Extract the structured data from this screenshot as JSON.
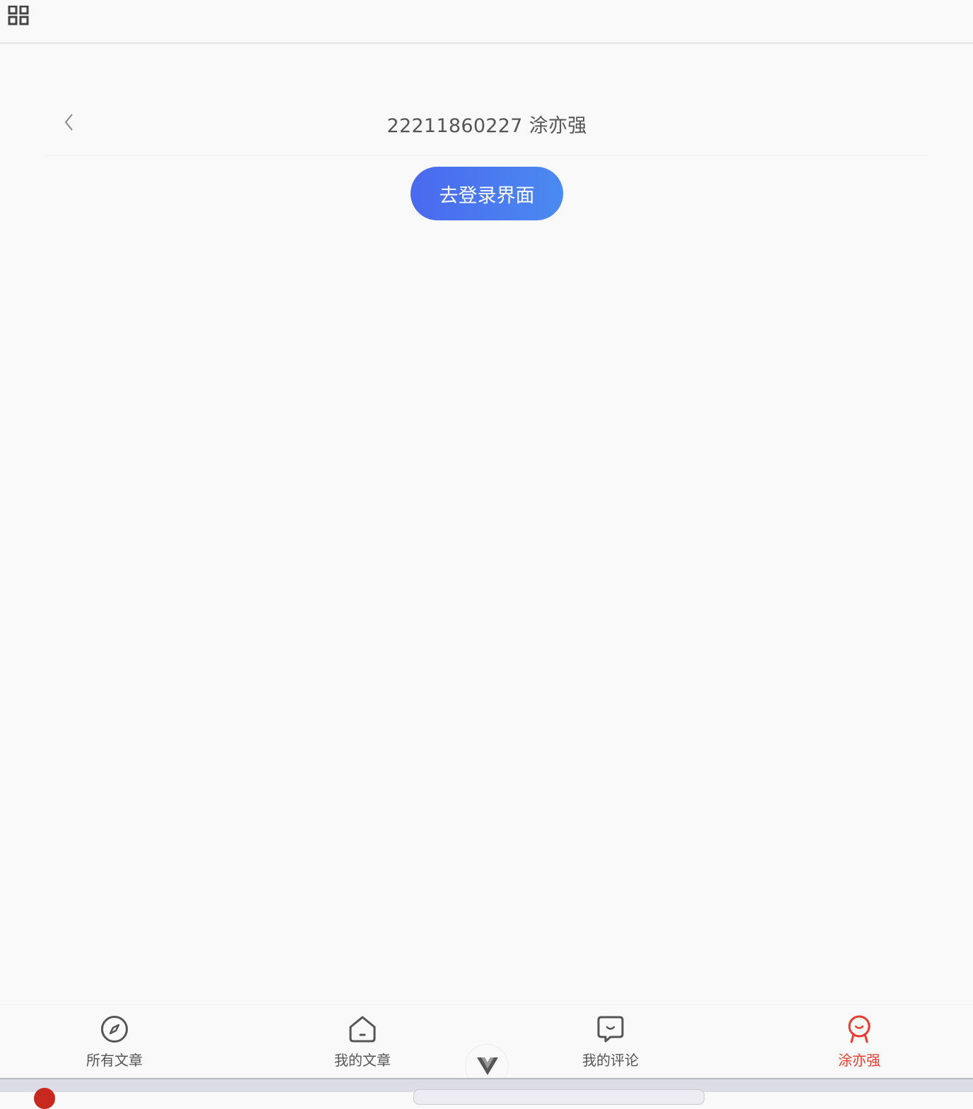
{
  "app": {
    "menu_icon": "grid-menu-icon"
  },
  "page": {
    "back_icon": "chevron-left-icon",
    "title": "22211860227 涂亦强",
    "login_button": "去登录界面"
  },
  "tabbar": {
    "items": [
      {
        "label": "所有文章",
        "icon": "compass-icon",
        "active": false
      },
      {
        "label": "我的文章",
        "icon": "home-icon",
        "active": false
      },
      {
        "label": "我的评论",
        "icon": "comment-icon",
        "active": false
      },
      {
        "label": "涂亦强",
        "icon": "user-award-icon",
        "active": true
      }
    ]
  },
  "devtools": {
    "icon": "vue-logo-icon"
  },
  "colors": {
    "accent_active": "#ee3a2c",
    "button_gradient_start": "#4a69ef",
    "button_gradient_end": "#4b8af0"
  }
}
